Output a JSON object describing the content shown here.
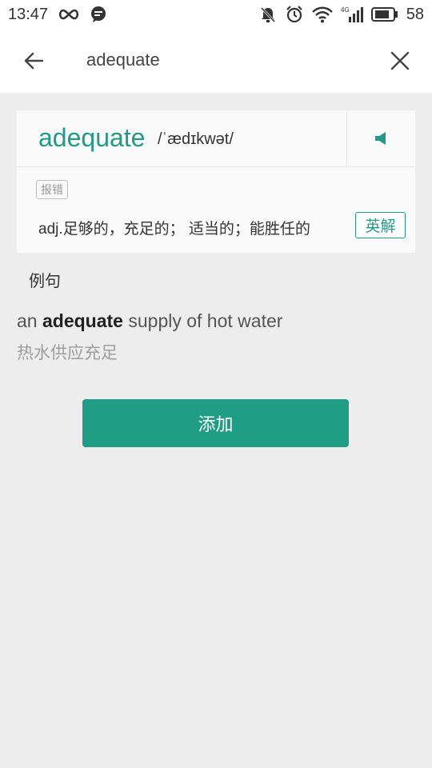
{
  "status_bar": {
    "time": "13:47",
    "battery": "58",
    "network": "4G"
  },
  "search": {
    "query": "adequate"
  },
  "word": {
    "headword": "adequate",
    "phonetic": "/ˈædɪkwət/",
    "report_label": "报错",
    "definition": "adj.足够的，充足的； 适当的；能胜任的",
    "english_def_label": "英解"
  },
  "examples": {
    "section_title": "例句",
    "items": [
      {
        "en_prefix": "an ",
        "en_keyword": "adequate",
        "en_suffix": " supply of hot water",
        "zh": "热水供应充足"
      }
    ]
  },
  "actions": {
    "add_label": "添加"
  },
  "colors": {
    "accent": "#1f9d85",
    "background": "#ededed"
  }
}
